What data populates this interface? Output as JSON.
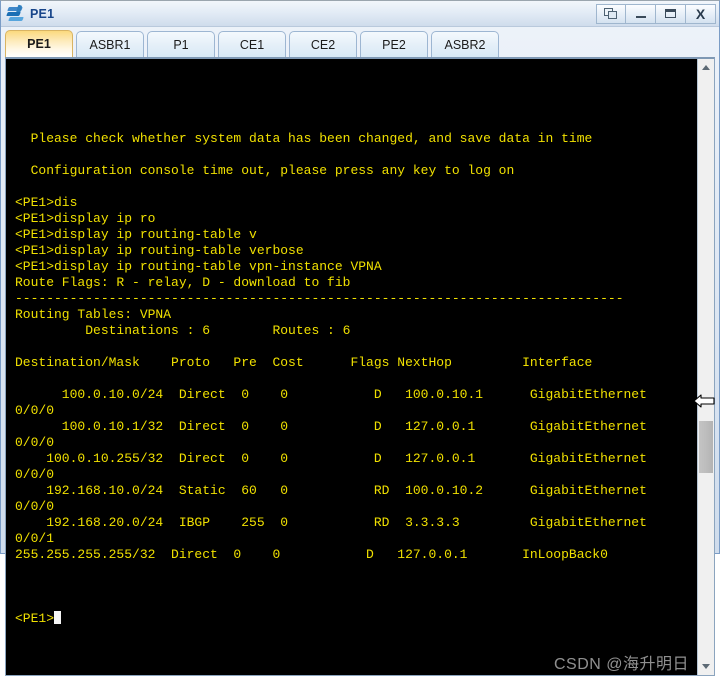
{
  "window": {
    "title": "PE1",
    "icon": "ensp-device-icon",
    "buttons": [
      {
        "name": "cascade-windows-button",
        "label": ""
      },
      {
        "name": "minimize-button",
        "label": ""
      },
      {
        "name": "maximize-button",
        "label": ""
      },
      {
        "name": "close-button",
        "label": "X"
      }
    ]
  },
  "tabs": [
    {
      "label": "PE1",
      "active": true
    },
    {
      "label": "ASBR1",
      "active": false
    },
    {
      "label": "P1",
      "active": false
    },
    {
      "label": "CE1",
      "active": false
    },
    {
      "label": "CE2",
      "active": false
    },
    {
      "label": "PE2",
      "active": false
    },
    {
      "label": "ASBR2",
      "active": false
    }
  ],
  "terminal": {
    "foreground": "#f0e000",
    "background": "#000000",
    "prompt": "<PE1>",
    "lines": [
      "",
      "  Please check whether system data has been changed, and save data in time",
      "",
      "  Configuration console time out, please press any key to log on",
      "",
      "<PE1>dis",
      "<PE1>display ip ro",
      "<PE1>display ip routing-table v",
      "<PE1>display ip routing-table verbose",
      "<PE1>display ip routing-table vpn-instance VPNA",
      "Route Flags: R - relay, D - download to fib",
      "------------------------------------------------------------------------------",
      "Routing Tables: VPNA",
      "         Destinations : 6        Routes : 6",
      "",
      "Destination/Mask    Proto   Pre  Cost      Flags NextHop         Interface",
      "",
      "      100.0.10.0/24  Direct  0    0           D   100.0.10.1      GigabitEthernet",
      "0/0/0",
      "      100.0.10.1/32  Direct  0    0           D   127.0.0.1       GigabitEthernet",
      "0/0/0",
      "    100.0.10.255/32  Direct  0    0           D   127.0.0.1       GigabitEthernet",
      "0/0/0",
      "    192.168.10.0/24  Static  60   0           RD  100.0.10.2      GigabitEthernet",
      "0/0/0",
      "    192.168.20.0/24  IBGP    255  0           RD  3.3.3.3         GigabitEthernet",
      "0/0/1",
      "255.255.255.255/32  Direct  0    0           D   127.0.0.1       InLoopBack0",
      ""
    ],
    "last_prompt": "<PE1>",
    "route_flags": {
      "R": "relay",
      "D": "download to fib"
    },
    "routing_table": {
      "name": "VPNA",
      "destinations": 6,
      "routes": 6,
      "columns": [
        "Destination/Mask",
        "Proto",
        "Pre",
        "Cost",
        "Flags",
        "NextHop",
        "Interface"
      ],
      "rows": [
        {
          "destination": "100.0.10.0/24",
          "proto": "Direct",
          "pre": "0",
          "cost": "0",
          "flags": "D",
          "nexthop": "100.0.10.1",
          "interface": "GigabitEthernet0/0/0"
        },
        {
          "destination": "100.0.10.1/32",
          "proto": "Direct",
          "pre": "0",
          "cost": "0",
          "flags": "D",
          "nexthop": "127.0.0.1",
          "interface": "GigabitEthernet0/0/0"
        },
        {
          "destination": "100.0.10.255/32",
          "proto": "Direct",
          "pre": "0",
          "cost": "0",
          "flags": "D",
          "nexthop": "127.0.0.1",
          "interface": "GigabitEthernet0/0/0"
        },
        {
          "destination": "192.168.10.0/24",
          "proto": "Static",
          "pre": "60",
          "cost": "0",
          "flags": "RD",
          "nexthop": "100.0.10.2",
          "interface": "GigabitEthernet0/0/0"
        },
        {
          "destination": "192.168.20.0/24",
          "proto": "IBGP",
          "pre": "255",
          "cost": "0",
          "flags": "RD",
          "nexthop": "3.3.3.3",
          "interface": "GigabitEthernet0/0/1"
        },
        {
          "destination": "255.255.255.255/32",
          "proto": "Direct",
          "pre": "0",
          "cost": "0",
          "flags": "D",
          "nexthop": "127.0.0.1",
          "interface": "InLoopBack0"
        }
      ]
    }
  },
  "watermark": "CSDN @海升明日",
  "scrollbar": {
    "up_arrow": "scroll-up-arrow-icon",
    "down_arrow": "scroll-down-arrow-icon"
  },
  "colors": {
    "terminal_text": "#f0e000",
    "terminal_bg": "#000000",
    "active_tab": "#fbd97e",
    "title_text": "#17458a"
  }
}
